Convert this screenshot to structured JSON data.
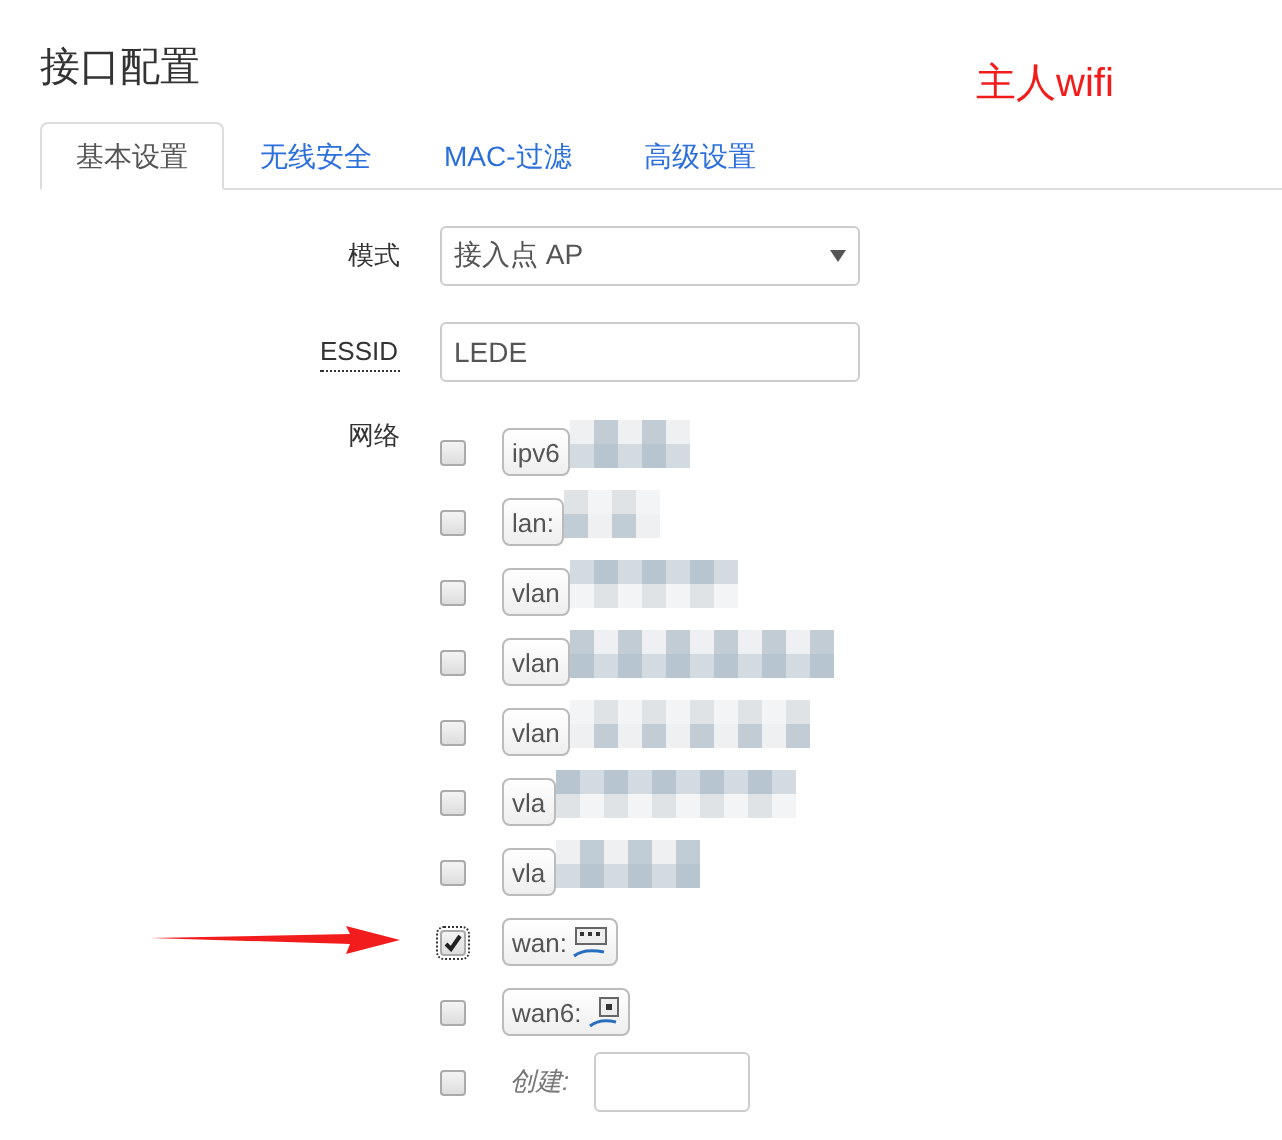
{
  "title": "接口配置",
  "annotation": "主人wifi",
  "tabs": [
    {
      "label": "基本设置",
      "selected": true
    },
    {
      "label": "无线安全",
      "selected": false
    },
    {
      "label": "MAC-过滤",
      "selected": false
    },
    {
      "label": "高级设置",
      "selected": false
    }
  ],
  "mode": {
    "label": "模式",
    "value": "接入点 AP"
  },
  "essid": {
    "label": "ESSID",
    "value": "LEDE"
  },
  "network": {
    "label": "网络",
    "items": [
      {
        "label": "ipv6",
        "checked": false,
        "kind": "redacted"
      },
      {
        "label": "lan:",
        "checked": false,
        "kind": "redacted"
      },
      {
        "label": "vlan",
        "checked": false,
        "kind": "redacted"
      },
      {
        "label": "vlan",
        "checked": false,
        "kind": "redacted"
      },
      {
        "label": "vlan",
        "checked": false,
        "kind": "redacted"
      },
      {
        "label": "vla",
        "checked": false,
        "kind": "redacted"
      },
      {
        "label": "vla",
        "checked": false,
        "kind": "redacted"
      },
      {
        "label": "wan:",
        "checked": true,
        "kind": "switch"
      },
      {
        "label": "wan6:",
        "checked": false,
        "kind": "port"
      }
    ],
    "create": {
      "label": "创建:",
      "checked": false
    }
  }
}
